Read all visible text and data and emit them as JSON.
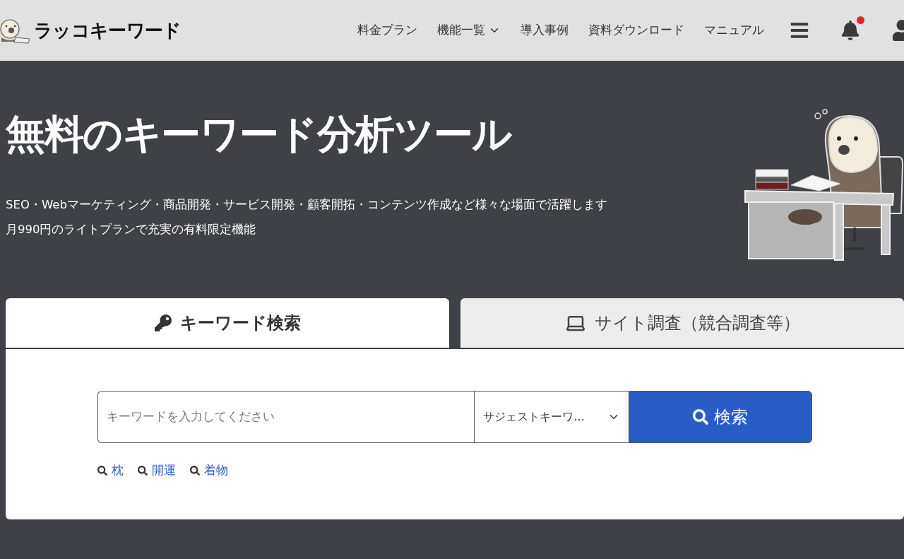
{
  "header": {
    "logo_text": "ラッコキーワード",
    "nav": [
      {
        "label": "料金プラン",
        "dropdown": false
      },
      {
        "label": "機能一覧",
        "dropdown": true
      },
      {
        "label": "導入事例",
        "dropdown": false
      },
      {
        "label": "資料ダウンロード",
        "dropdown": false
      },
      {
        "label": "マニュアル",
        "dropdown": false
      }
    ],
    "notification_badge": true
  },
  "hero": {
    "title": "無料のキーワード分析ツール",
    "lines": [
      "SEO・Webマーケティング・商品開発・サービス開発・顧客開拓・コンテンツ作成など様々な場面で活躍します",
      "月990円のライトプランで充実の有料限定機能"
    ]
  },
  "tabs": [
    {
      "label": "キーワード検索",
      "kind": "key",
      "selected": true
    },
    {
      "label": "サイト調査（競合調査等）",
      "kind": "laptop",
      "selected": false
    }
  ],
  "search": {
    "placeholder": "キーワードを入力してください",
    "mode": "サジェストキーワ…",
    "button": "検索"
  },
  "suggestions": [
    "枕",
    "開運",
    "着物"
  ]
}
